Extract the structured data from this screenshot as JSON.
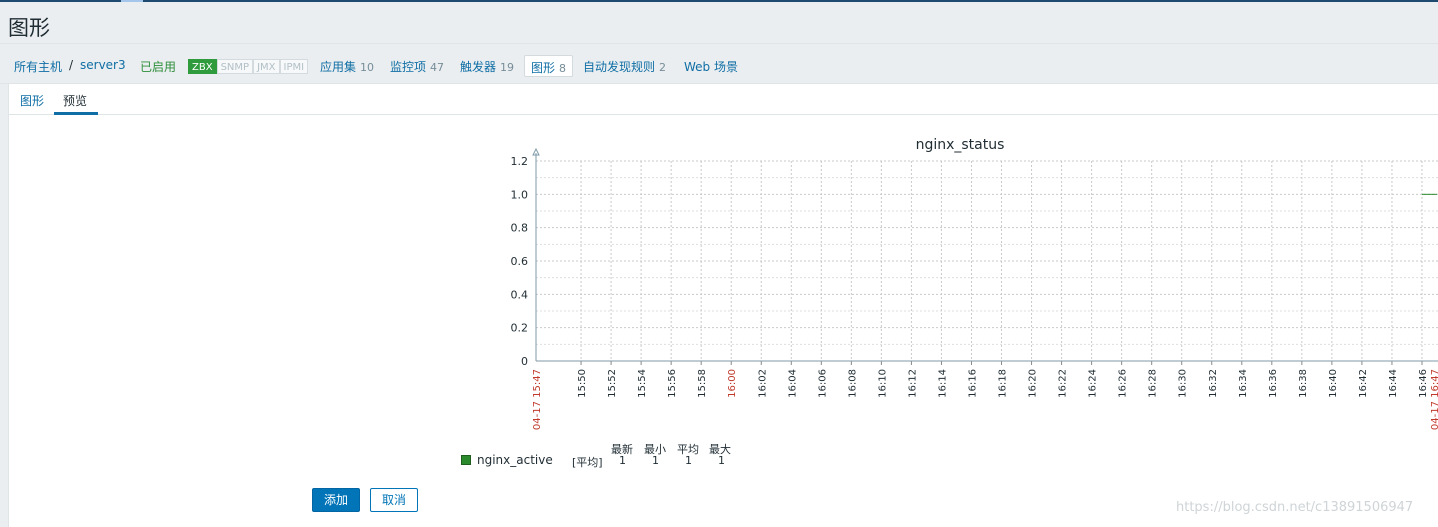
{
  "page_title": "图形",
  "nav": {
    "all_hosts": "所有主机",
    "separator": "/",
    "host": "server3",
    "status": "已启用",
    "badges": [
      "ZBX",
      "SNMP",
      "JMX",
      "IPMI"
    ],
    "applications": {
      "label": "应用集",
      "count": "10"
    },
    "items": {
      "label": "监控项",
      "count": "47"
    },
    "triggers": {
      "label": "触发器",
      "count": "19"
    },
    "graphs": {
      "label": "图形",
      "count": "8"
    },
    "discovery": {
      "label": "自动发现规则",
      "count": "2"
    },
    "web": {
      "label": "Web 场景"
    }
  },
  "tabs": [
    "图形",
    "预览"
  ],
  "legend": {
    "color": "#2b8a2b",
    "name": "nginx_active",
    "function": "[平均]",
    "headers": [
      "最新",
      "最小",
      "平均",
      "最大"
    ],
    "values": [
      "1",
      "1",
      "1",
      "1"
    ]
  },
  "buttons": {
    "add": "添加",
    "cancel": "取消"
  },
  "watermark": "https://blog.csdn.net/c13891506947",
  "chart_data": {
    "type": "line",
    "title": "nginx_status",
    "ylim": [
      0,
      1.2
    ],
    "yticks": [
      "0",
      "0.2",
      "0.4",
      "0.6",
      "0.8",
      "1.0",
      "1.2"
    ],
    "xticks": [
      "15:50",
      "15:52",
      "15:54",
      "15:56",
      "15:58",
      "16:00",
      "16:02",
      "16:04",
      "16:06",
      "16:08",
      "16:10",
      "16:12",
      "16:14",
      "16:16",
      "16:18",
      "16:20",
      "16:22",
      "16:24",
      "16:26",
      "16:28",
      "16:30",
      "16:32",
      "16:34",
      "16:36",
      "16:38",
      "16:40",
      "16:42",
      "16:44",
      "16:46"
    ],
    "x_start_label": "04-17 15:47",
    "x_end_label": "04-17 16:47",
    "highlight_tick": "16:00",
    "grid": true,
    "series": [
      {
        "name": "nginx_active",
        "color": "#2b8a2b",
        "x": [
          "16:46",
          "16:47"
        ],
        "values": [
          1,
          1
        ]
      }
    ]
  }
}
